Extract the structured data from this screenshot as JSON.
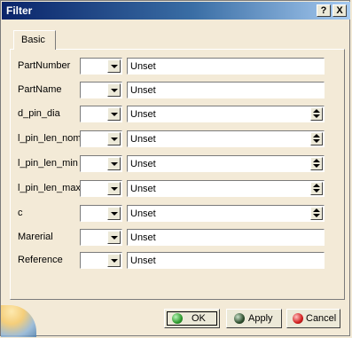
{
  "window": {
    "title": "Filter",
    "help_label": "?",
    "close_label": "X"
  },
  "tabs": [
    {
      "label": "Basic"
    }
  ],
  "rows": [
    {
      "label": "PartNumber",
      "value": "Unset",
      "has_spinner": false
    },
    {
      "label": "PartName",
      "value": "Unset",
      "has_spinner": false
    },
    {
      "label": "d_pin_dia",
      "value": "Unset",
      "has_spinner": true
    },
    {
      "label": "l_pin_len_nom",
      "value": "Unset",
      "has_spinner": true
    },
    {
      "label": "l_pin_len_min",
      "value": "Unset",
      "has_spinner": true
    },
    {
      "label": "l_pin_len_max",
      "value": "Unset",
      "has_spinner": true
    },
    {
      "label": "c",
      "value": "Unset",
      "has_spinner": true
    },
    {
      "label": "Marerial",
      "value": "Unset",
      "has_spinner": false
    },
    {
      "label": "Reference",
      "value": "Unset",
      "has_spinner": false
    }
  ],
  "buttons": {
    "ok": "OK",
    "apply": "Apply",
    "cancel": "Cancel"
  },
  "colors": {
    "ok_icon": "#2e9a2e",
    "apply_icon": "#2f4f2f",
    "cancel_icon": "#d21f1f",
    "title_bar": "#0a246a"
  }
}
